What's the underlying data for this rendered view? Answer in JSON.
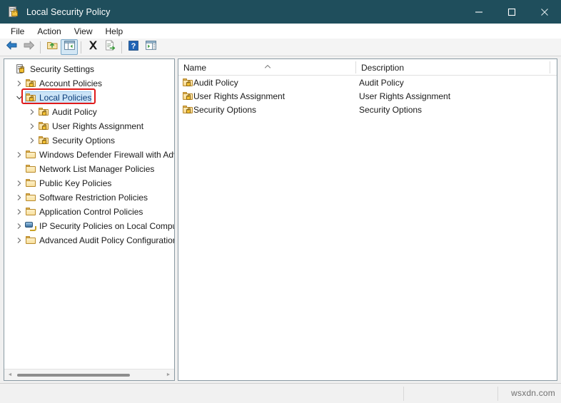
{
  "window": {
    "title": "Local Security Policy",
    "app_icon": "security-policy-icon",
    "accent_titlebar": "#1f4e5c",
    "controls": {
      "minimize": "minimize-button",
      "maximize": "maximize-button",
      "close": "close-button"
    }
  },
  "menubar": {
    "items": [
      {
        "label": "File"
      },
      {
        "label": "Action"
      },
      {
        "label": "View"
      },
      {
        "label": "Help"
      }
    ]
  },
  "toolbar": {
    "items": [
      {
        "name": "back-button",
        "icon": "back-arrow-icon",
        "state": "enabled"
      },
      {
        "name": "forward-button",
        "icon": "forward-arrow-icon",
        "state": "disabled"
      },
      {
        "name": "separator-1",
        "icon": "separator"
      },
      {
        "name": "up-one-level-button",
        "icon": "folder-up-icon",
        "state": "enabled"
      },
      {
        "name": "show-hide-console-tree-button",
        "icon": "console-tree-icon",
        "state": "pressed"
      },
      {
        "name": "separator-2",
        "icon": "separator"
      },
      {
        "name": "delete-button",
        "icon": "delete-x-icon",
        "state": "enabled"
      },
      {
        "name": "export-list-button",
        "icon": "export-list-icon",
        "state": "enabled"
      },
      {
        "name": "separator-3",
        "icon": "separator"
      },
      {
        "name": "help-button",
        "icon": "help-question-icon",
        "state": "enabled"
      },
      {
        "name": "show-action-pane-button",
        "icon": "action-pane-icon",
        "state": "enabled"
      }
    ]
  },
  "tree": {
    "selected": "Local Policies",
    "annotation_color": "#e01b1b",
    "items": [
      {
        "label": "Security Settings",
        "depth": 0,
        "expander": "none",
        "icon": "security-settings-icon"
      },
      {
        "label": "Account Policies",
        "depth": 1,
        "expander": "collapsed",
        "icon": "locked-folder-icon"
      },
      {
        "label": "Local Policies",
        "depth": 1,
        "expander": "expanded",
        "icon": "locked-folder-icon",
        "selected": true,
        "annotated": true
      },
      {
        "label": "Audit Policy",
        "depth": 2,
        "expander": "collapsed",
        "icon": "locked-folder-icon"
      },
      {
        "label": "User Rights Assignment",
        "depth": 2,
        "expander": "collapsed",
        "icon": "locked-folder-icon"
      },
      {
        "label": "Security Options",
        "depth": 2,
        "expander": "collapsed",
        "icon": "locked-folder-icon"
      },
      {
        "label": "Windows Defender Firewall with Adva",
        "depth": 1,
        "expander": "collapsed",
        "icon": "folder-icon"
      },
      {
        "label": "Network List Manager Policies",
        "depth": 1,
        "expander": "none",
        "icon": "folder-icon"
      },
      {
        "label": "Public Key Policies",
        "depth": 1,
        "expander": "collapsed",
        "icon": "folder-icon"
      },
      {
        "label": "Software Restriction Policies",
        "depth": 1,
        "expander": "collapsed",
        "icon": "folder-icon"
      },
      {
        "label": "Application Control Policies",
        "depth": 1,
        "expander": "collapsed",
        "icon": "folder-icon"
      },
      {
        "label": "IP Security Policies on Local Compute",
        "depth": 1,
        "expander": "collapsed",
        "icon": "ip-security-icon"
      },
      {
        "label": "Advanced Audit Policy Configuration",
        "depth": 1,
        "expander": "collapsed",
        "icon": "folder-icon"
      }
    ],
    "scrollbar": {
      "orientation": "horizontal",
      "visible": true
    }
  },
  "list": {
    "columns": [
      {
        "label": "Name",
        "sorted": "ascending"
      },
      {
        "label": "Description",
        "sorted": "none"
      }
    ],
    "rows": [
      {
        "name": "Audit Policy",
        "description": "Audit Policy",
        "icon": "locked-folder-icon"
      },
      {
        "name": "User Rights Assignment",
        "description": "User Rights Assignment",
        "icon": "locked-folder-icon"
      },
      {
        "name": "Security Options",
        "description": "Security Options",
        "icon": "locked-folder-icon"
      }
    ]
  },
  "statusbar": {
    "segments": [
      "",
      "",
      ""
    ],
    "watermark": "wsxdn.com"
  }
}
